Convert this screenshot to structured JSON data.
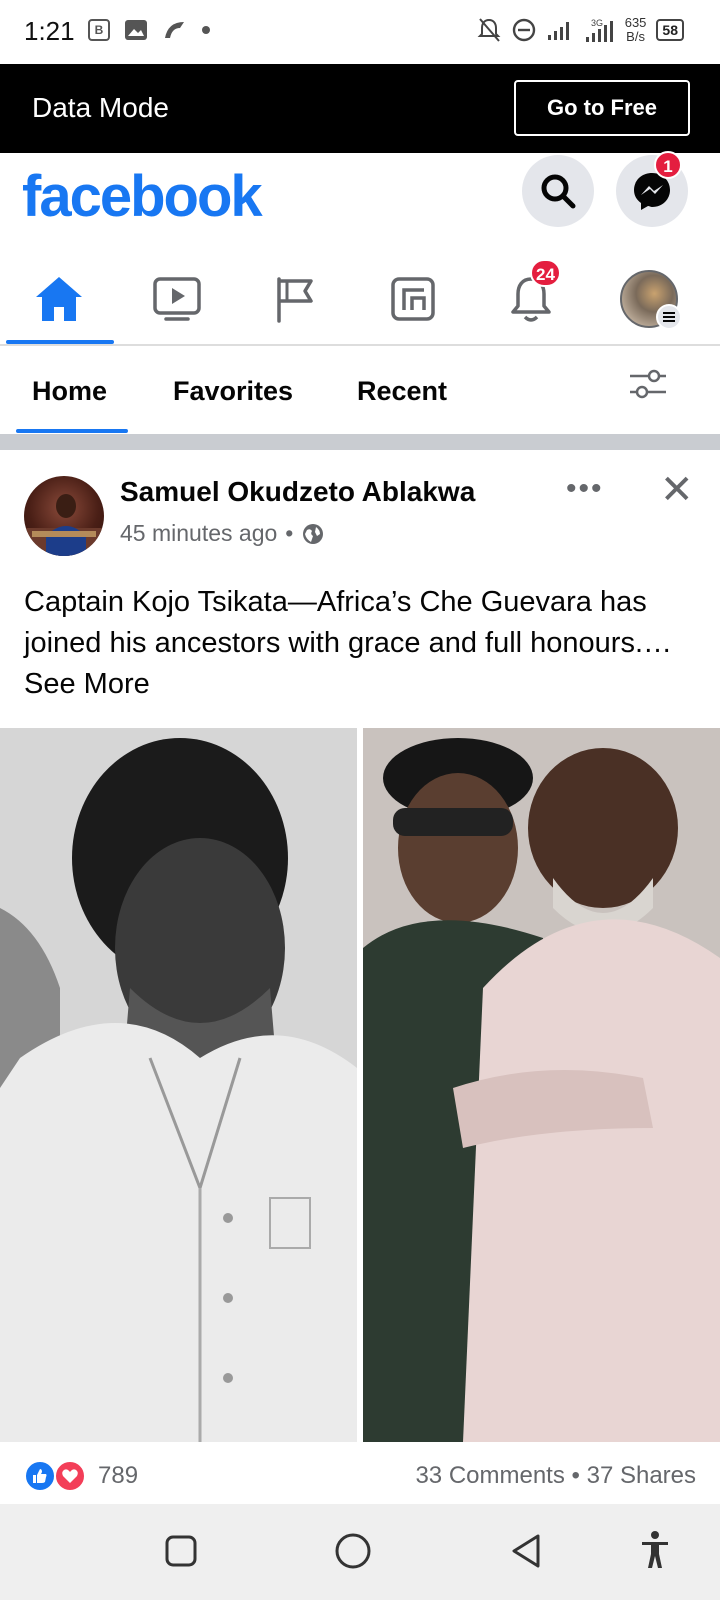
{
  "status_bar": {
    "time": "1:21",
    "net_speed_value": "635",
    "net_speed_unit": "B/s",
    "battery": "58",
    "icons": [
      "b-icon",
      "gallery-icon",
      "wifi-calling-icon",
      "dot-icon",
      "mute-icon",
      "dnd-icon",
      "signal-icon",
      "3g-signal-icon"
    ]
  },
  "data_mode_bar": {
    "label": "Data Mode",
    "button": "Go to Free"
  },
  "header": {
    "logo": "facebook",
    "messenger_badge": "1",
    "brand_color": "#1877f2"
  },
  "nav": {
    "items": [
      "home",
      "watch",
      "pages",
      "feeds",
      "notifications",
      "menu"
    ],
    "notification_badge": "24"
  },
  "feed_tabs": {
    "tabs": [
      "Home",
      "Favorites",
      "Recent"
    ],
    "active": "Home"
  },
  "post": {
    "author": "Samuel Okudzeto Ablakwa",
    "time": "45 minutes ago",
    "separator": "•",
    "text": "Captain Kojo Tsikata—Africa’s Che Guevara has joined his ancestors with grace and full honours.… See More",
    "text_main": "Captain Kojo Tsikata—Africa’s Che Guevara has joined his ancestors with grace and full honours.…",
    "see_more": "See More",
    "reaction_count": "789",
    "comments": "33 Comments",
    "shares": "37 Shares",
    "stats_separator": "•"
  }
}
